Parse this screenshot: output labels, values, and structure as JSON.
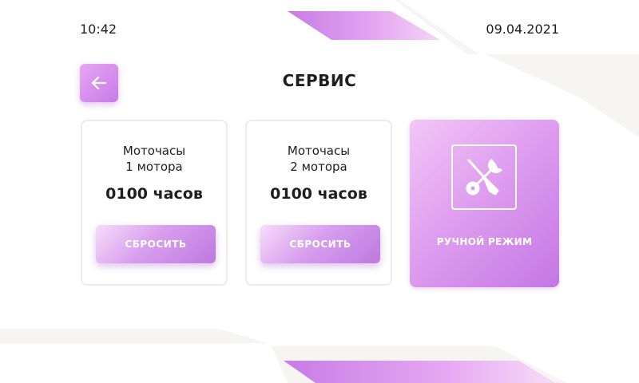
{
  "status_bar": {
    "time": "10:42",
    "date": "09.04.2021"
  },
  "header": {
    "title": "СЕРВИС",
    "back_icon": "arrow-left-icon"
  },
  "cards": [
    {
      "label_line1": "Моточасы",
      "label_line2": "1 мотора",
      "value": "0100 часов",
      "button_label": "СБРОСИТЬ"
    },
    {
      "label_line1": "Моточасы",
      "label_line2": "2 мотора",
      "value": "0100 часов",
      "button_label": "СБРОСИТЬ"
    }
  ],
  "manual_mode": {
    "label": "РУЧНОЙ РЕЖИМ",
    "icon": "tools-icon"
  },
  "colors": {
    "accent": "#c67be8",
    "accent_light": "#f3c6f7",
    "text": "#1e1e1e",
    "band": "#f6f5f4"
  }
}
